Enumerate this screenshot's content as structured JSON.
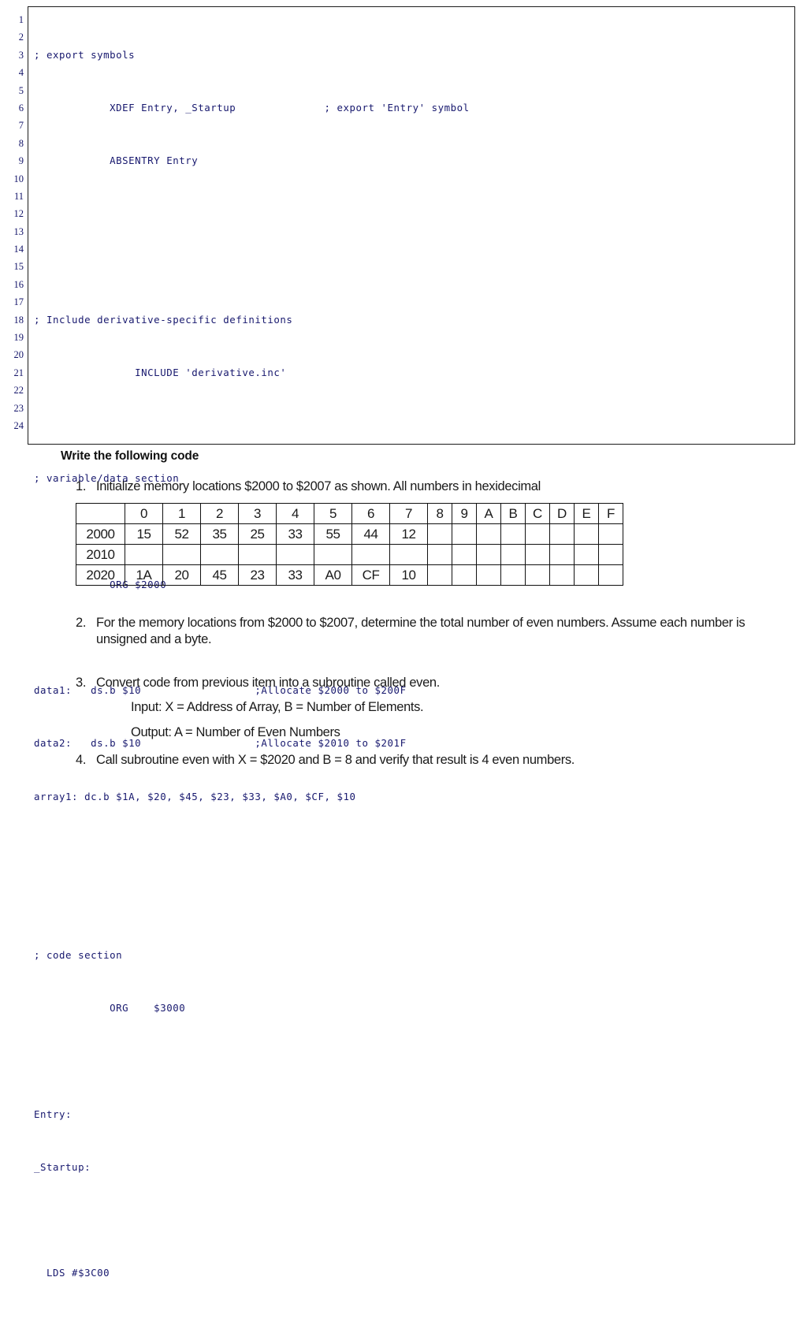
{
  "code_listing": {
    "line_numbers": [
      "1",
      "2",
      "3",
      "4",
      "5",
      "6",
      "7",
      "8",
      "9",
      "10",
      "11",
      "12",
      "13",
      "14",
      "15",
      "16",
      "17",
      "18",
      "19",
      "20",
      "21",
      "22",
      "23",
      "24"
    ],
    "lines": [
      "; export symbols",
      "            XDEF Entry, _Startup              ; export 'Entry' symbol",
      "            ABSENTRY Entry",
      "",
      "",
      "; Include derivative-specific definitions",
      "                INCLUDE 'derivative.inc'",
      "",
      "; variable/data section",
      "",
      "            ORG $2000",
      "",
      "data1:   ds.b $10                  ;Allocate $2000 to $200F",
      "data2:   ds.b $10                  ;Allocate $2010 to $201F",
      "array1: dc.b $1A, $20, $45, $23, $33, $A0, $CF, $10",
      "",
      "",
      "; code section",
      "            ORG    $3000",
      "",
      "Entry:",
      "_Startup:",
      "",
      "  LDS #$3C00"
    ]
  },
  "prose": {
    "heading": "Write the following code",
    "items": [
      {
        "number": "1.",
        "text": "Initialize memory locations $2000 to $2007 as shown. All numbers in hexidecimal"
      },
      {
        "number": "2.",
        "text": "For the memory locations from $2000 to $2007, determine the total number of even numbers. Assume each number is unsigned and a byte."
      },
      {
        "number": "3.",
        "text": "Convert code from previous item into a subroutine called even."
      },
      {
        "number": "4.",
        "text": "Call subroutine even with X = $2020 and B = 8 and verify that result is 4 even numbers."
      }
    ],
    "sub_lines": {
      "input": "Input: X = Address of Array, B = Number of Elements.",
      "output": "Output: A = Number of Even Numbers"
    }
  },
  "memory_table": {
    "corner_label": "",
    "column_headers": [
      "0",
      "1",
      "2",
      "3",
      "4",
      "5",
      "6",
      "7",
      "8",
      "9",
      "A",
      "B",
      "C",
      "D",
      "E",
      "F"
    ],
    "rows": [
      {
        "address": "2000",
        "cells": [
          "15",
          "52",
          "35",
          "25",
          "33",
          "55",
          "44",
          "12",
          "",
          "",
          "",
          "",
          "",
          "",
          "",
          ""
        ]
      },
      {
        "address": "2010",
        "cells": [
          "",
          "",
          "",
          "",
          "",
          "",
          "",
          "",
          "",
          "",
          "",
          "",
          "",
          "",
          "",
          ""
        ]
      },
      {
        "address": "2020",
        "cells": [
          "1A",
          "20",
          "45",
          "23",
          "33",
          "A0",
          "CF",
          "10",
          "",
          "",
          "",
          "",
          "",
          "",
          "",
          ""
        ]
      }
    ]
  }
}
